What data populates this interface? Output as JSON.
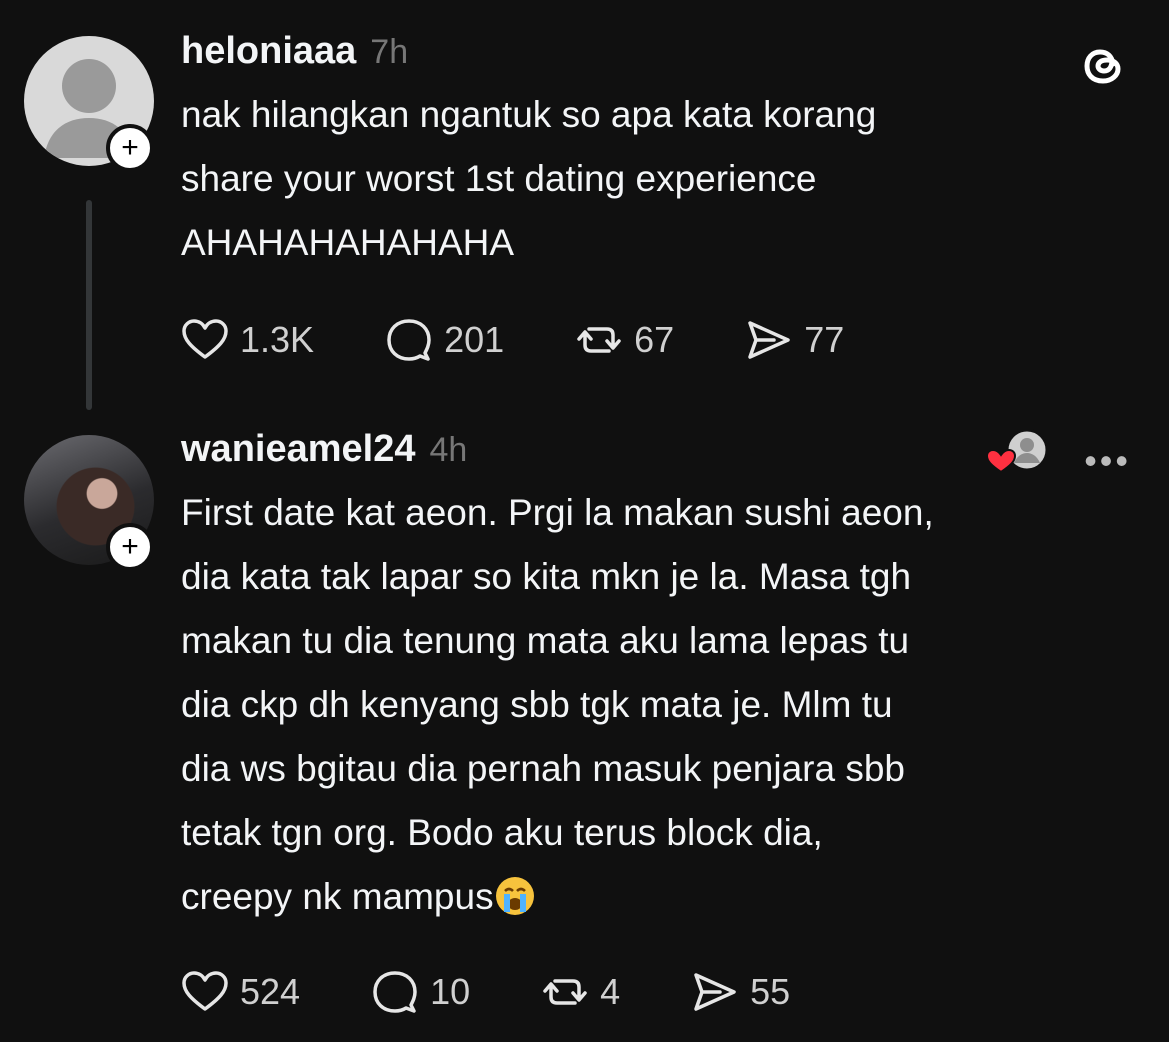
{
  "post1": {
    "username": "heloniaaa",
    "time": "7h",
    "text": "nak hilangkan ngantuk so apa kata korang\nshare your worst 1st dating experience\nAHAHAHAHAHAHA",
    "likes": "1.3K",
    "comments": "201",
    "reposts": "67",
    "shares": "77"
  },
  "post2": {
    "username": "wanieamel24",
    "time": "4h",
    "text": "First date kat aeon. Prgi la makan sushi aeon,\ndia kata tak lapar so kita mkn je la. Masa tgh\nmakan tu dia tenung mata aku lama lepas tu\ndia ckp dh kenyang sbb tgk mata je. Mlm tu\ndia ws bgitau dia pernah masuk penjara sbb\ntetak tgn org. Bodo aku terus block dia,\ncreepy nk mampus",
    "likes": "524",
    "comments": "10",
    "reposts": "4",
    "shares": "55"
  },
  "icons": {
    "app_logo": "threads-logo-icon",
    "like": "heart-icon",
    "comment": "speech-bubble-icon",
    "repost": "repost-icon",
    "share": "send-icon",
    "emoji": "loudly-crying-face-emoji"
  },
  "colors": {
    "background": "#101010",
    "text": "#f3f5f7",
    "muted": "#777777",
    "heart_red": "#ff3040"
  }
}
